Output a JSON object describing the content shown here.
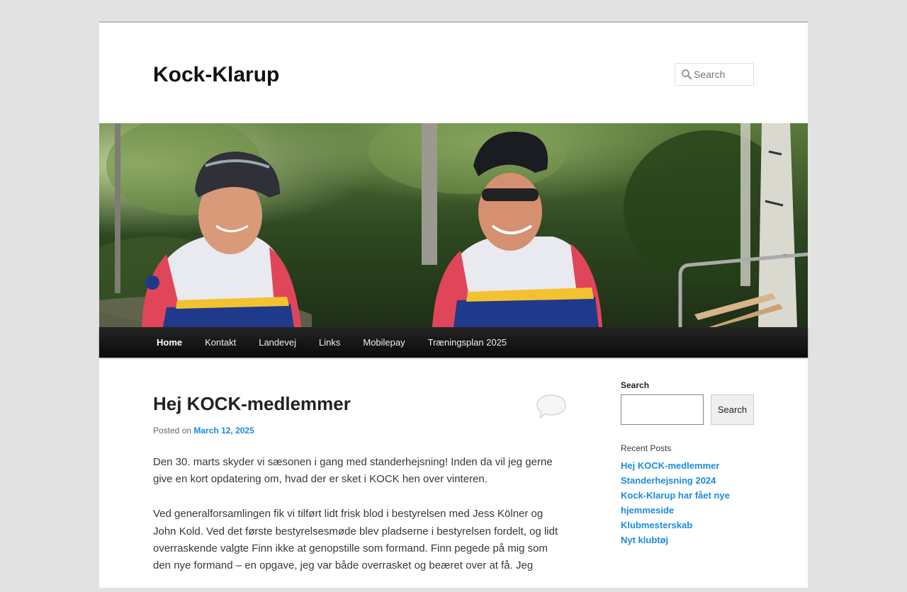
{
  "site": {
    "title": "Kock-Klarup"
  },
  "header_search": {
    "placeholder": "Search",
    "icon": "search-icon"
  },
  "header_image": {
    "alt": "Two cyclists in club jerseys"
  },
  "nav": {
    "items": [
      {
        "label": "Home",
        "current": true
      },
      {
        "label": "Kontakt"
      },
      {
        "label": "Landevej"
      },
      {
        "label": "Links"
      },
      {
        "label": "Mobilepay"
      },
      {
        "label": "Træningsplan 2025"
      }
    ]
  },
  "post": {
    "title": "Hej KOCK-medlemmer",
    "posted_on_label": "Posted on",
    "date": "March 12, 2025",
    "comment_icon": "comment-bubble-icon",
    "paragraphs": [
      "Den 30. marts skyder vi sæsonen i gang med standerhejsning! Inden da vil jeg gerne give en kort opdatering om, hvad der er sket i KOCK hen over vinteren.",
      "Ved generalforsamlingen fik vi tilført lidt frisk blod i bestyrelsen med Jess Kölner og John Kold. Ved det første bestyrelsesmøde blev pladserne i bestyrelsen fordelt, og lidt overraskende valgte Finn ikke at genopstille som formand. Finn pegede på mig som den nye formand – en opgave, jeg var både overrasket og beæret over at få. Jeg"
    ]
  },
  "sidebar": {
    "search_title": "Search",
    "search_button": "Search",
    "recent_title": "Recent Posts",
    "recent_posts": [
      "Hej KOCK-medlemmer",
      "Standerhejsning 2024",
      "Kock-Klarup har fået nye hjemmeside",
      "Klubmesterskab",
      "Nyt klubtøj"
    ]
  },
  "colors": {
    "link": "#1b8be0",
    "nav_bg": "#1a1a1a",
    "page_bg": "#e2e2e2"
  }
}
